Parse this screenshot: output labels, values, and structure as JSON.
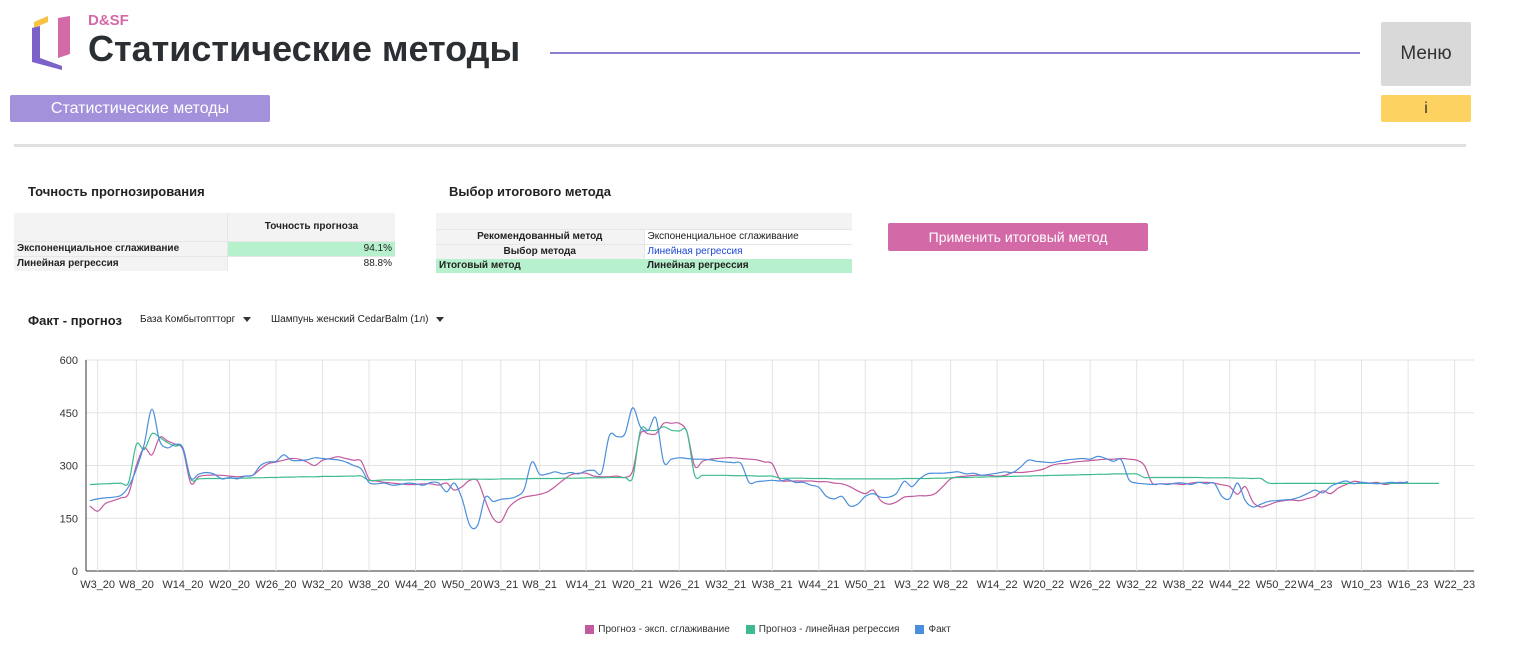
{
  "header": {
    "brand": "D&SF",
    "title": "Статистические методы",
    "menu_label": "Меню",
    "info_label": "i",
    "tab_label": "Статистические методы",
    "logo_colors": [
      "#7b61c9",
      "#d36aa7",
      "#f6c342"
    ]
  },
  "accuracy": {
    "title": "Точность прогнозирования",
    "column_header": "Точность прогноза",
    "rows": [
      {
        "method": "Экспоненциальное сглаживание",
        "value": "94.1%"
      },
      {
        "method": "Линейная регрессия",
        "value": "88.8%"
      }
    ]
  },
  "selection": {
    "title": "Выбор итогового метода",
    "rows": [
      {
        "label": "Рекомендованный метод",
        "value": "Экспоненциальное сглаживание"
      },
      {
        "label": "Выбор метода",
        "value": "Линейная регрессия"
      },
      {
        "label": "Итоговый метод",
        "value": "Линейная регрессия"
      }
    ],
    "apply_label": "Применить итоговый метод"
  },
  "chart_section": {
    "title": "Факт - прогноз",
    "filter_base": "База Комбытоптторг",
    "filter_product": "Шампунь женский CedarBalm (1л)"
  },
  "colors": {
    "exp": "#c25a9f",
    "lin": "#3dbb8f",
    "fact": "#4a8fdc"
  },
  "chart_data": {
    "type": "line",
    "ylim": [
      0,
      600
    ],
    "yticks": [
      0,
      150,
      300,
      450,
      600
    ],
    "tick_labels": [
      "W3_20",
      "W8_20",
      "W14_20",
      "W20_20",
      "W26_20",
      "W32_20",
      "W38_20",
      "W44_20",
      "W50_20",
      "W3_21",
      "W8_21",
      "W14_21",
      "W20_21",
      "W26_21",
      "W32_21",
      "W38_21",
      "W44_21",
      "W50_21",
      "W3_22",
      "W8_22",
      "W14_22",
      "W20_22",
      "W26_22",
      "W32_22",
      "W38_22",
      "W44_22",
      "W50_22",
      "W4_23",
      "W10_23",
      "W16_23",
      "W22_23"
    ],
    "tick_positions": [
      1,
      6,
      12,
      18,
      24,
      30,
      36,
      42,
      48,
      53,
      58,
      64,
      70,
      76,
      82,
      88,
      94,
      100,
      106,
      111,
      117,
      123,
      129,
      135,
      141,
      147,
      153,
      158,
      164,
      170,
      176
    ],
    "x_count": 179,
    "series": [
      {
        "name": "Прогноз - эксп. сглаживание",
        "color": "#c25a9f",
        "values": [
          185,
          170,
          192,
          200,
          208,
          220,
          300,
          350,
          330,
          380,
          370,
          360,
          345,
          250,
          268,
          272,
          273,
          272,
          270,
          268,
          270,
          272,
          290,
          305,
          310,
          315,
          320,
          318,
          310,
          300,
          315,
          320,
          325,
          320,
          315,
          312,
          262,
          256,
          252,
          250,
          248,
          246,
          246,
          248,
          248,
          244,
          250,
          230,
          240,
          258,
          256,
          200,
          150,
          140,
          180,
          200,
          210,
          214,
          218,
          225,
          240,
          258,
          273,
          278,
          278,
          270,
          268,
          268,
          270,
          266,
          285,
          390,
          390,
          390,
          420,
          420,
          420,
          395,
          298,
          312,
          318,
          320,
          322,
          322,
          320,
          318,
          316,
          310,
          305,
          260,
          256,
          256,
          256,
          256,
          254,
          254,
          250,
          248,
          240,
          228,
          220,
          230,
          200,
          190,
          196,
          210,
          212,
          214,
          214,
          220,
          240,
          262,
          268,
          270,
          272,
          272,
          272,
          270,
          272,
          280,
          280,
          282,
          285,
          290,
          300,
          305,
          306,
          310,
          312,
          314,
          316,
          318,
          318,
          320,
          318,
          315,
          300,
          250,
          248,
          248,
          248,
          246,
          250,
          252,
          252,
          250,
          245,
          240,
          218,
          240,
          196,
          182,
          188,
          196,
          200,
          202,
          200,
          206,
          212,
          228,
          220,
          236,
          246,
          255,
          252,
          250,
          252,
          246,
          250,
          252,
          250
        ]
      },
      {
        "name": "Прогноз - линейная регрессия",
        "color": "#3dbb8f",
        "values": [
          246,
          247,
          248,
          249,
          250,
          252,
          360,
          345,
          390,
          380,
          365,
          355,
          350,
          262,
          262,
          263,
          263,
          263,
          264,
          264,
          264,
          265,
          265,
          266,
          266,
          267,
          267,
          268,
          268,
          268,
          269,
          269,
          269,
          270,
          270,
          270,
          258,
          258,
          259,
          259,
          259,
          259,
          260,
          260,
          260,
          260,
          260,
          261,
          261,
          261,
          261,
          261,
          261,
          262,
          262,
          262,
          262,
          263,
          263,
          263,
          263,
          264,
          264,
          264,
          265,
          265,
          265,
          266,
          266,
          266,
          266,
          400,
          400,
          400,
          410,
          400,
          398,
          396,
          272,
          272,
          272,
          272,
          272,
          271,
          271,
          271,
          270,
          270,
          270,
          264,
          264,
          264,
          264,
          263,
          263,
          263,
          262,
          262,
          262,
          262,
          262,
          262,
          262,
          262,
          262,
          263,
          263,
          263,
          263,
          264,
          264,
          265,
          266,
          266,
          267,
          267,
          268,
          268,
          269,
          269,
          270,
          270,
          271,
          271,
          272,
          272,
          273,
          273,
          274,
          274,
          275,
          275,
          276,
          276,
          276,
          276,
          266,
          266,
          266,
          266,
          266,
          266,
          266,
          266,
          265,
          265,
          265,
          265,
          264,
          264,
          263,
          263,
          250,
          249,
          249,
          249,
          249,
          249,
          249,
          249,
          249,
          249,
          249,
          249,
          249,
          249,
          249,
          249,
          249,
          249,
          249,
          249,
          249,
          249,
          249
        ]
      },
      {
        "name": "Факт",
        "color": "#4a8fdc",
        "values": [
          200,
          205,
          208,
          210,
          215,
          240,
          290,
          360,
          460,
          370,
          350,
          360,
          350,
          265,
          275,
          280,
          276,
          262,
          266,
          262,
          270,
          272,
          300,
          310,
          312,
          330,
          315,
          314,
          316,
          322,
          320,
          318,
          316,
          310,
          300,
          290,
          252,
          248,
          250,
          244,
          246,
          250,
          248,
          244,
          252,
          250,
          225,
          250,
          205,
          130,
          130,
          210,
          198,
          204,
          206,
          212,
          232,
          310,
          275,
          276,
          282,
          276,
          280,
          276,
          285,
          286,
          280,
          385,
          382,
          390,
          464,
          410,
          400,
          435,
          310,
          318,
          322,
          320,
          318,
          318,
          316,
          312,
          310,
          308,
          305,
          252,
          254,
          256,
          258,
          256,
          260,
          252,
          252,
          244,
          238,
          212,
          205,
          212,
          185,
          190,
          212,
          220,
          210,
          210,
          220,
          255,
          240,
          262,
          276,
          278,
          278,
          280,
          282,
          276,
          278,
          272,
          275,
          278,
          282,
          280,
          295,
          315,
          312,
          310,
          308,
          312,
          316,
          318,
          320,
          318,
          326,
          320,
          312,
          316,
          260,
          250,
          248,
          246,
          248,
          246,
          250,
          250,
          246,
          252,
          248,
          250,
          212,
          206,
          250,
          200,
          182,
          190,
          198,
          200,
          202,
          204,
          210,
          220,
          230,
          222,
          240,
          250,
          256,
          248,
          252,
          250,
          248,
          250,
          252,
          250,
          254
        ]
      }
    ]
  }
}
